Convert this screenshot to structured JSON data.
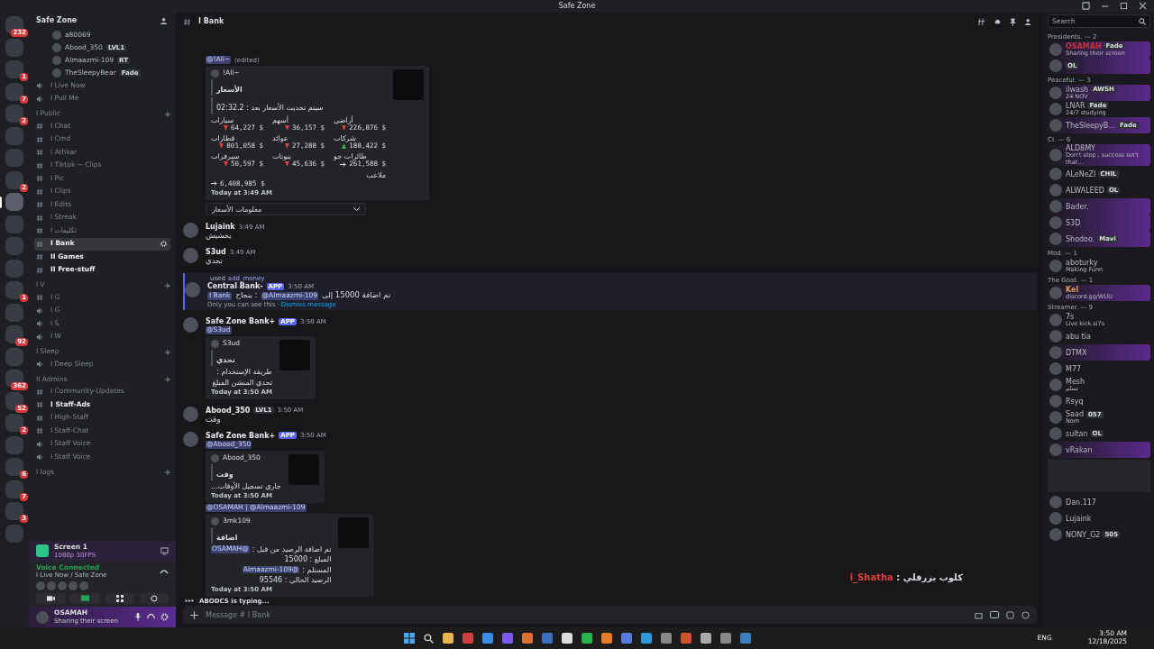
{
  "titlebar": {
    "title": "Safe Zone"
  },
  "servers": [
    {
      "badge": "232",
      "selected": false
    },
    {
      "selected": false
    },
    {
      "badge": "1",
      "selected": false
    },
    {
      "badge": "7",
      "selected": false
    },
    {
      "badge": "2",
      "selected": false
    },
    {
      "selected": false
    },
    {
      "selected": false
    },
    {
      "badge": "2",
      "selected": false
    },
    {
      "selected": true
    },
    {
      "selected": false
    },
    {
      "selected": false
    },
    {
      "selected": false
    },
    {
      "badge": "1",
      "selected": false
    },
    {
      "selected": false
    },
    {
      "badge": "92",
      "selected": false
    },
    {
      "selected": false
    },
    {
      "badge": "362",
      "selected": false
    },
    {
      "badge": "52",
      "selected": false
    },
    {
      "badge": "2",
      "selected": false
    },
    {
      "selected": false
    },
    {
      "badge": "6",
      "selected": false
    },
    {
      "badge": "7",
      "selected": false
    },
    {
      "badge": "3",
      "selected": false
    },
    {
      "selected": false
    }
  ],
  "sidebar": {
    "server_name": "Safe Zone",
    "voice_members": [
      {
        "name": "a80069"
      },
      {
        "name": "Abood_350",
        "tag": "LVL1"
      },
      {
        "name": "Almaazmi-109",
        "tag": "RT"
      },
      {
        "name": "TheSleepyBear",
        "tag": "Fade"
      }
    ],
    "channels": [
      {
        "kind": "voice",
        "name": "I Live Now"
      },
      {
        "kind": "voice",
        "name": "I Pull Me"
      },
      {
        "kind": "category",
        "name": "I Public"
      },
      {
        "kind": "text",
        "name": "I Chat",
        "selected": false,
        "unread": false
      },
      {
        "kind": "text",
        "name": "I Cmd",
        "selected": false,
        "unread": false
      },
      {
        "kind": "text",
        "name": "I Athkar",
        "selected": false,
        "unread": false
      },
      {
        "kind": "text",
        "name": "I Tiktok ~ Clips",
        "selected": false,
        "unread": false
      },
      {
        "kind": "text",
        "name": "I Pic",
        "selected": false,
        "unread": false
      },
      {
        "kind": "text",
        "name": "I Clips",
        "selected": false,
        "unread": false
      },
      {
        "kind": "text",
        "name": "I Edits",
        "selected": false,
        "unread": false
      },
      {
        "kind": "text",
        "name": "I Streak",
        "selected": false,
        "unread": false
      },
      {
        "kind": "text",
        "name": "I تكليفات",
        "selected": false,
        "unread": false
      },
      {
        "kind": "text",
        "name": "I Bank",
        "selected": true,
        "unread": false
      },
      {
        "kind": "text",
        "name": "II Games",
        "selected": false,
        "unread": true
      },
      {
        "kind": "text",
        "name": "II Free-stuff",
        "selected": false,
        "unread": true
      },
      {
        "kind": "category",
        "name": "I V"
      },
      {
        "kind": "text",
        "name": "I G",
        "selected": false,
        "unread": false
      },
      {
        "kind": "voice",
        "name": "I G"
      },
      {
        "kind": "voice",
        "name": "I S"
      },
      {
        "kind": "voice",
        "name": "I W"
      },
      {
        "kind": "category",
        "name": "I Sleep"
      },
      {
        "kind": "voice",
        "name": "I Deep Sleep"
      },
      {
        "kind": "category",
        "name": "II Admins"
      },
      {
        "kind": "text",
        "name": "I Community-Updates",
        "selected": false,
        "unread": false
      },
      {
        "kind": "text",
        "name": "I Staff-Ads",
        "selected": false,
        "unread": true
      },
      {
        "kind": "text",
        "name": "I High-Staff",
        "selected": false,
        "unread": false
      },
      {
        "kind": "text",
        "name": "I Staff-Chat",
        "selected": false,
        "unread": false
      },
      {
        "kind": "voice",
        "name": "I Staff Voice"
      },
      {
        "kind": "voice",
        "name": "I Staff Voice"
      },
      {
        "kind": "category",
        "name": "I logs"
      }
    ],
    "stream": {
      "title": "Screen 1",
      "quality": "1080p 30FPS"
    },
    "voice": {
      "status": "Voice Connected",
      "location": "I Live Now / Safe Zone"
    },
    "user": {
      "name": "OSAMAH",
      "status": "Sharing their screen"
    }
  },
  "chat": {
    "channel": "I Bank",
    "messages": [
      {
        "kind": "continued",
        "mention": "@!Ali~",
        "edited": "(edited)",
        "embeds": [
          {
            "author": "!Ali~",
            "title": "الأسعار",
            "subtitle": "سيتم تحديث الأسعار بعد : 02:32.2",
            "stock_rows": [
              {
                "labels": [
                  "أراضي",
                  "أسهم",
                  "سيارات"
                ],
                "values": [
                  {
                    "value": "64,227 $",
                    "kind": "down"
                  },
                  {
                    "value": "36,157 $",
                    "kind": "down"
                  },
                  {
                    "value": "226,876 $",
                    "kind": "down"
                  }
                ]
              },
              {
                "labels": [
                  "شركات",
                  "عوائد",
                  "قطارات"
                ],
                "values": [
                  {
                    "value": "801,058 $",
                    "kind": "down"
                  },
                  {
                    "value": "27,288 $",
                    "kind": "down"
                  },
                  {
                    "value": "188,422 $",
                    "kind": "up"
                  }
                ]
              },
              {
                "labels": [
                  "طائرات جو",
                  "بيوتات",
                  "سيرفرات"
                ],
                "values": [
                  {
                    "value": "50,597 $",
                    "kind": "down"
                  },
                  {
                    "value": "45,636 $",
                    "kind": "down"
                  },
                  {
                    "value": "261,588 $",
                    "kind": "flat"
                  }
                ]
              }
            ],
            "total": {
              "name": "ملاعب",
              "value": "6,408,985 $",
              "kind": "flat"
            },
            "footer": "Today at 3:49 AM",
            "select": "معلومات الأسعار"
          }
        ]
      },
      {
        "kind": "message",
        "author": "Lujaink",
        "time": "3:49 AM",
        "text": "بخشيش"
      },
      {
        "kind": "message",
        "author": "S3ud",
        "time": "3:49 AM",
        "text": "تحدي"
      },
      {
        "kind": "command",
        "author": "Central Bank-",
        "app": "APP",
        "time": "3:50 AM",
        "used": "used",
        "command": "add_money",
        "parts": [
          {
            "kind": "channel",
            "text": "I Bank"
          },
          {
            "kind": "text",
            "text": "بنجاح :"
          },
          {
            "kind": "mention",
            "text": "@Almaazmi-109"
          },
          {
            "kind": "text",
            "text": "تم اضافة 15000 إلى"
          }
        ],
        "ephemeral": "Only you can see this ·",
        "dismiss": "Dismiss message"
      },
      {
        "kind": "message",
        "author": "Safe Zone Bank+",
        "app": "APP",
        "time": "3:50 AM",
        "embeds": [
          {
            "mention": "@S3ud",
            "author": "S3ud",
            "title": "تحدي",
            "lines": [
              {
                "text": "طريقة الإستخدام :"
              },
              {
                "text": "تحدي  المنشن  المبلغ"
              }
            ],
            "footer": "Today at 3:50 AM"
          }
        ]
      },
      {
        "kind": "message",
        "author": "Abood_350",
        "tag": "LVL1",
        "time": "3:50 AM",
        "text": "وقت"
      },
      {
        "kind": "message",
        "author": "Safe Zone Bank+",
        "app": "APP",
        "time": "3:50 AM",
        "embeds": [
          {
            "mention": "@Abood_350",
            "author": "Abood_350",
            "title": "وقت",
            "lines": [
              {
                "text": "جاري تسجيل الأوقات..."
              }
            ],
            "footer": "Today at 3:50 AM"
          },
          {
            "mention": "@OSAMAH | @Almaazmi-109",
            "author": "3mk109",
            "title": "اضافة",
            "lines": [
              {
                "text": "تم اضافة الرصيد من قبل :",
                "mention": "@OSAMAH"
              },
              {
                "text": "المبلغ : 15000"
              },
              {
                "text": "المستلم :",
                "mention": "@Almaazmi-109"
              },
              {
                "text": "الرصيد الحالي : 95546"
              }
            ],
            "footer": "Today at 3:50 AM"
          }
        ]
      }
    ],
    "typing": "ABODCS is typing...",
    "overlay": {
      "text": "كلوب يزرقلي :",
      "name": "i_Shatha"
    },
    "input": {
      "placeholder": "Message # I Bank"
    }
  },
  "members": {
    "search": {
      "placeholder": "Search"
    },
    "groups": [
      {
        "title": "Presidents. — 2",
        "members": [
          {
            "name": "OSAMAH",
            "color": "#c8323c",
            "tag": "Fade",
            "status": "Sharing their screen",
            "nameplate": true
          },
          {
            "tag": "OL",
            "nameplate": true
          }
        ]
      },
      {
        "title": "Peaceful. — 3",
        "members": [
          {
            "name": "ilwash",
            "tag": "AWSH",
            "status": "24 NOV",
            "nameplate": true
          },
          {
            "name": "LNAR",
            "tag": "Fade",
            "status": "24/7 studying",
            "nameplate": false
          },
          {
            "name": "TheSleepyB...",
            "tag": "Fade",
            "nameplate": true
          }
        ]
      },
      {
        "title": "CI. — 6",
        "members": [
          {
            "name": "ALD8MY",
            "status": "Don't stop , success isn't that...",
            "nameplate": true
          },
          {
            "name": "ALeNeZI",
            "tag": "CHIL",
            "nameplate": false
          },
          {
            "name": "ALWALEED",
            "tag": "OL",
            "nameplate": false
          },
          {
            "name": "Bader.",
            "nameplate": true
          },
          {
            "name": "S3D",
            "nameplate": true
          },
          {
            "name": "Shodoo.",
            "tag": "Mavi",
            "nameplate": true
          }
        ]
      },
      {
        "title": "Mod. — 1",
        "members": [
          {
            "name": "aboturky",
            "status": "Making Funn",
            "nameplate": false
          }
        ]
      },
      {
        "title": "The Goat. — 1",
        "members": [
          {
            "name": "Kel",
            "color": "#e0a040",
            "status": "discord.gg/WUU",
            "nameplate": true
          }
        ]
      },
      {
        "title": "Streamer. — 9",
        "members": [
          {
            "name": "7s",
            "status": "Live kick.si7s",
            "nameplate": false
          },
          {
            "name": "abu tia",
            "nameplate": false
          },
          {
            "name": "DTMX",
            "nameplate": true
          },
          {
            "name": "M77",
            "nameplate": false
          },
          {
            "name": "Mesh",
            "status": "تسلم",
            "nameplate": false
          },
          {
            "name": "Rsyq",
            "nameplate": false
          },
          {
            "name": "Saad",
            "tag": "057",
            "status": "Nom",
            "nameplate": false
          },
          {
            "name": "sultan",
            "tag": "OL",
            "nameplate": false
          },
          {
            "name": "vRakan",
            "nameplate": true
          }
        ]
      },
      {
        "members": [
          {
            "name": "Dan.117",
            "nameplate": false
          },
          {
            "name": "Lujaink",
            "nameplate": false
          },
          {
            "name": "NONY_G2",
            "tag": "505",
            "nameplate": false
          }
        ]
      }
    ]
  },
  "taskbar": {
    "language": "ENG",
    "time": "3:50 AM",
    "date": "12/18/2025"
  }
}
